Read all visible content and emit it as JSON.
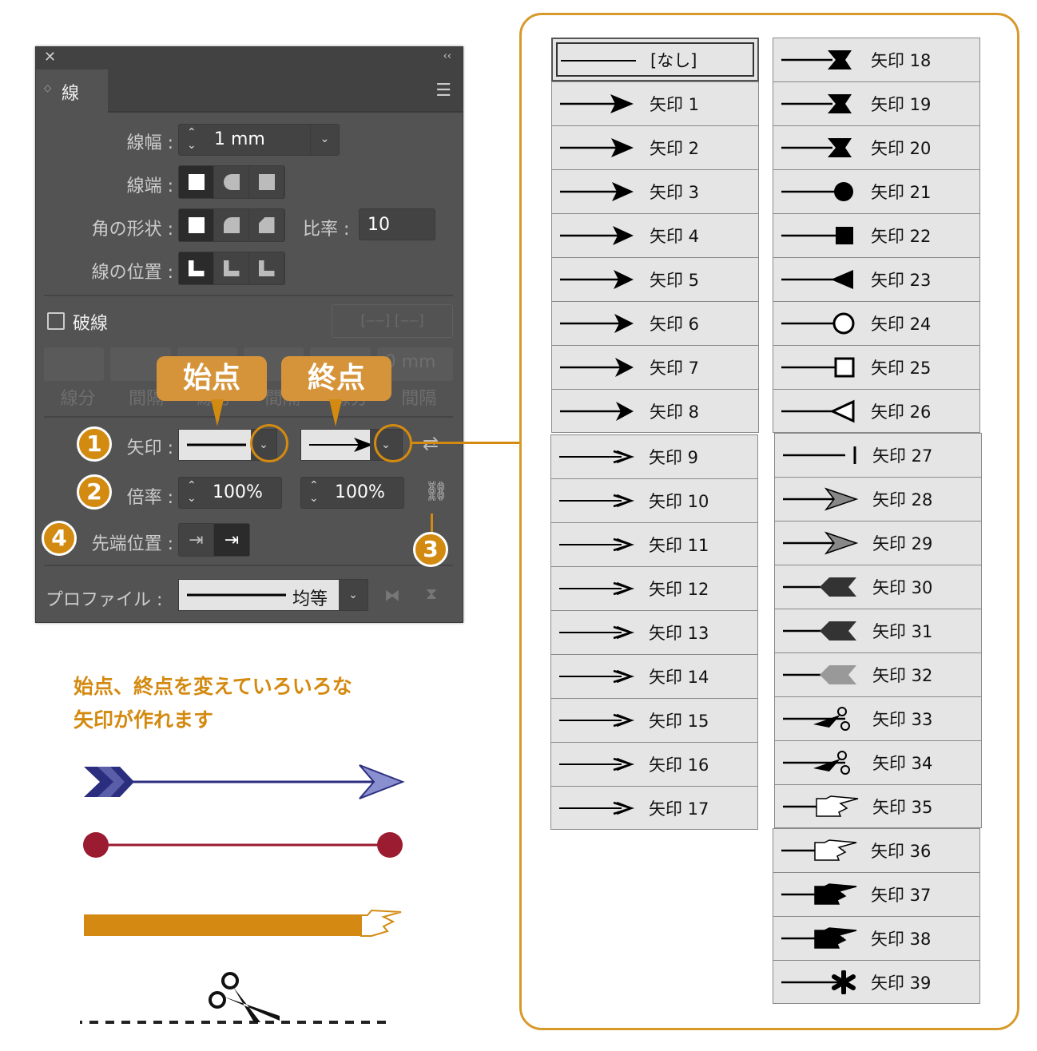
{
  "panel": {
    "tab_title": "線",
    "stroke_width": {
      "label": "線幅 :",
      "value": "1 mm"
    },
    "cap_label": "線端 :",
    "corner_label": "角の形状 :",
    "miter": {
      "label": "比率 :",
      "value": "10"
    },
    "align_label": "線の位置 :",
    "dashed": {
      "label": "破線",
      "checked": false
    },
    "dash_value": "0 mm",
    "dash_labels": [
      "線分",
      "間隔",
      "線分",
      "間隔",
      "線分",
      "間隔"
    ],
    "arrow_label": "矢印 :",
    "scale_label": "倍率 :",
    "scale_start": "100%",
    "scale_end": "100%",
    "tip_label": "先端位置 :",
    "profile": {
      "label": "プロファイル :",
      "value": "均等"
    }
  },
  "callouts": {
    "start": "始点",
    "end": "終点"
  },
  "badges": [
    "1",
    "2",
    "3",
    "4"
  ],
  "caption": [
    "始点、終点を変えていろいろな",
    "矢印が作れます"
  ],
  "colors": {
    "accent": "#d38a10",
    "panel": "#535353",
    "blue_arrow": "#2b2e7e",
    "red_line": "#9b1b30",
    "orange_bar": "#d48a12"
  },
  "arrowheads": [
    "[なし]",
    "矢印 1",
    "矢印 2",
    "矢印 3",
    "矢印 4",
    "矢印 5",
    "矢印 6",
    "矢印 7",
    "矢印 8",
    "矢印 9",
    "矢印 10",
    "矢印 11",
    "矢印 12",
    "矢印 13",
    "矢印 14",
    "矢印 15",
    "矢印 16",
    "矢印 17",
    "矢印 18",
    "矢印 19",
    "矢印 20",
    "矢印 21",
    "矢印 22",
    "矢印 23",
    "矢印 24",
    "矢印 25",
    "矢印 26",
    "矢印 27",
    "矢印 28",
    "矢印 29",
    "矢印 30",
    "矢印 31",
    "矢印 32",
    "矢印 33",
    "矢印 34",
    "矢印 35",
    "矢印 36",
    "矢印 37",
    "矢印 38",
    "矢印 39"
  ]
}
